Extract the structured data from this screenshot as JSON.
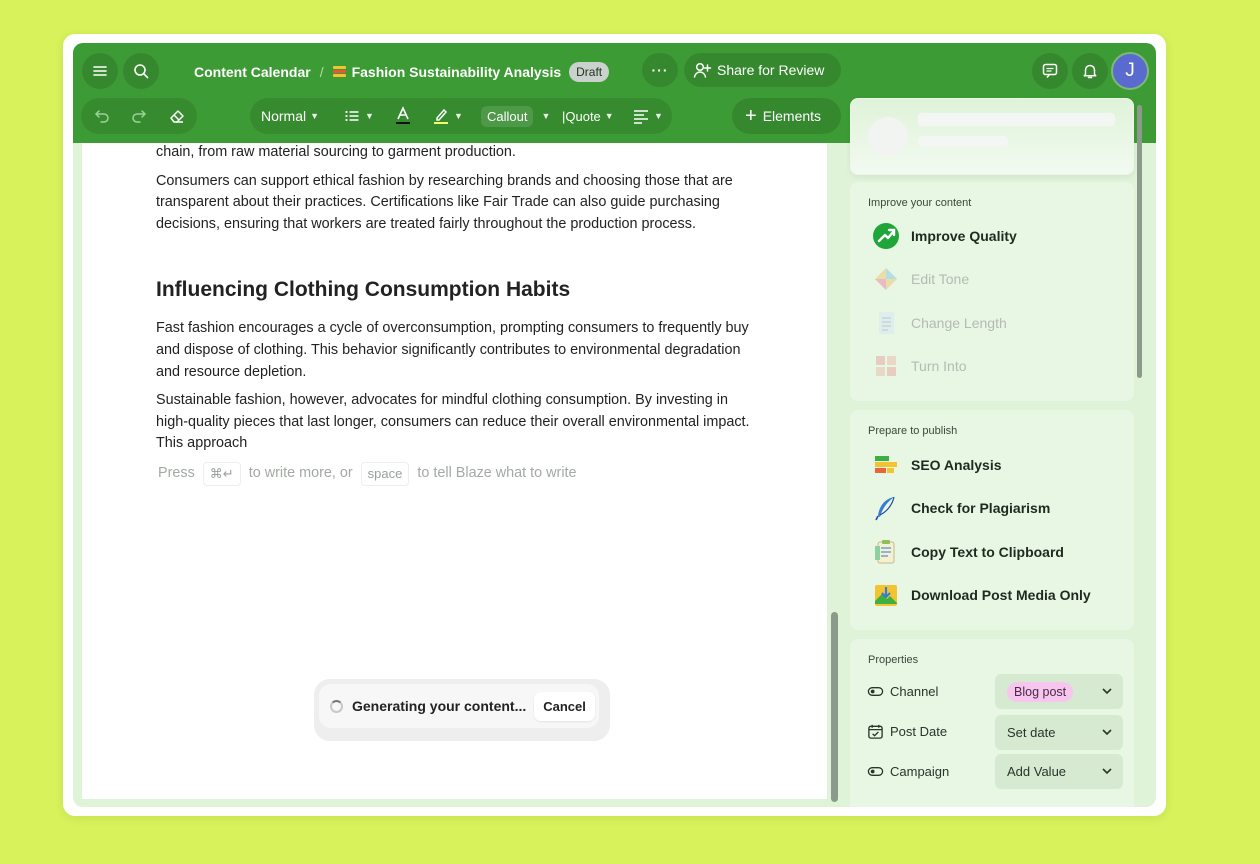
{
  "header": {
    "breadcrumb_root": "Content Calendar",
    "breadcrumb_sep": "/",
    "doc_title": "Fashion Sustainability Analysis",
    "doc_status": "Draft",
    "more_label": "···",
    "share_label": "Share for Review",
    "avatar_initial": "J"
  },
  "toolbar": {
    "style_label": "Normal",
    "callout_label": "Callout",
    "quote_label": "|Quote",
    "elements_label": "Elements"
  },
  "document": {
    "paragraphs_top": [
      "chain, from raw material sourcing to garment production.",
      "Consumers can support ethical fashion by researching brands and choosing those that are transparent about their practices. Certifications like Fair Trade can also guide purchasing decisions, ensuring that workers are treated fairly throughout the production process."
    ],
    "heading": "Influencing Clothing Consumption Habits",
    "paragraphs_bottom": [
      "Fast fashion encourages a cycle of overconsumption, prompting consumers to frequently buy and dispose of clothing. This behavior significantly contributes to environmental degradation and resource depletion.",
      "Sustainable fashion, however, advocates for mindful clothing consumption. By investing in high-quality pieces that last longer, consumers can reduce their overall environmental impact. This approach"
    ],
    "hint": {
      "press": "Press",
      "key1": "⌘↵",
      "middle": "to write more, or",
      "key2": "space",
      "end": "to tell Blaze what to write"
    }
  },
  "generating": {
    "status": "Generating your content...",
    "cancel_label": "Cancel"
  },
  "panel": {
    "improve": {
      "title": "Improve your content",
      "items": [
        "Improve Quality",
        "Edit Tone",
        "Change Length",
        "Turn Into"
      ]
    },
    "publish": {
      "title": "Prepare to publish",
      "items": [
        "SEO Analysis",
        "Check for Plagiarism",
        "Copy Text to Clipboard",
        "Download Post Media Only"
      ]
    },
    "properties": {
      "title": "Properties",
      "rows": [
        {
          "label": "Channel",
          "value": "Blog post"
        },
        {
          "label": "Post Date",
          "value": "Set date"
        },
        {
          "label": "Campaign",
          "value": "Add Value"
        }
      ]
    }
  },
  "colors": {
    "header_green": "#3d9b35",
    "page_background": "#d7f25a",
    "panel_background": "#dff3d9",
    "avatar": "#5a6bd0",
    "channel_tag": "#f6c6ef"
  }
}
